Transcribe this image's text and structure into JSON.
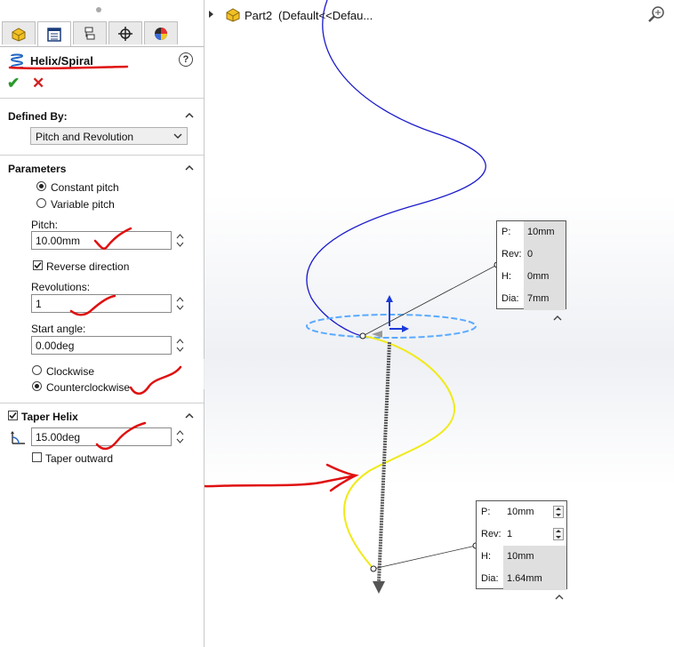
{
  "panel": {
    "title": "Helix/Spiral",
    "help_label": "?",
    "defined_by": {
      "header": "Defined By:",
      "selected": "Pitch and Revolution"
    },
    "parameters": {
      "header": "Parameters",
      "constant_pitch": "Constant pitch",
      "variable_pitch": "Variable pitch",
      "pitch_label": "Pitch:",
      "pitch_value": "10.00mm",
      "reverse_direction": "Reverse direction",
      "revolutions_label": "Revolutions:",
      "revolutions_value": "1",
      "start_angle_label": "Start angle:",
      "start_angle_value": "0.00deg",
      "clockwise": "Clockwise",
      "counterclockwise": "Counterclockwise"
    },
    "taper": {
      "header": "Taper Helix",
      "angle_value": "15.00deg",
      "taper_outward": "Taper outward"
    }
  },
  "tree": {
    "part": "Part2",
    "config": "(Default<<Defau..."
  },
  "callout_top": {
    "rows": [
      {
        "key": "P:",
        "value": "10mm"
      },
      {
        "key": "Rev:",
        "value": "0"
      },
      {
        "key": "H:",
        "value": "0mm"
      },
      {
        "key": "Dia:",
        "value": "7mm"
      }
    ]
  },
  "callout_bottom": {
    "rows": [
      {
        "key": "P:",
        "value": "10mm"
      },
      {
        "key": "Rev:",
        "value": "1"
      },
      {
        "key": "H:",
        "value": "10mm"
      },
      {
        "key": "Dia:",
        "value": "1.64mm"
      }
    ]
  },
  "colors": {
    "helix_blue": "#1a1acc",
    "helix_yellow": "#f0ea1a",
    "circle_blue": "#5aaaff",
    "annotation_red": "#e01010"
  }
}
